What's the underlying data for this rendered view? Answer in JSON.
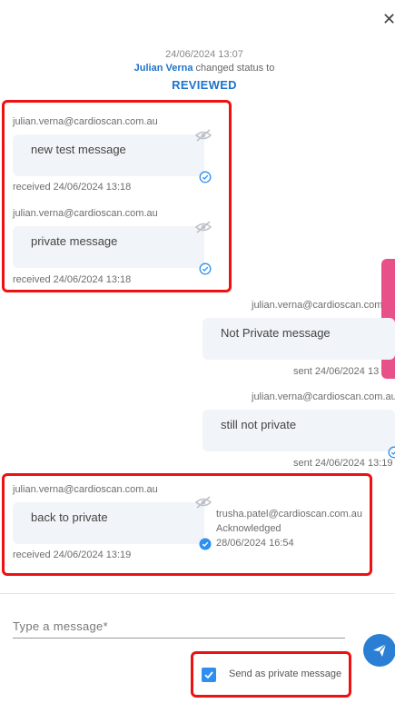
{
  "header": {
    "close_glyph": "✕"
  },
  "status_event": {
    "timestamp": "24/06/2024 13:07",
    "actor": "Julian Verna",
    "action_text": " changed status to",
    "new_status": "REVIEWED"
  },
  "messages": [
    {
      "sender": "julian.verna@cardioscan.com.au",
      "text": "new test message",
      "meta": "received 24/06/2024 13:18",
      "direction": "received",
      "private": true
    },
    {
      "sender": "julian.verna@cardioscan.com.au",
      "text": "private message",
      "meta": "received 24/06/2024 13:18",
      "direction": "received",
      "private": true
    },
    {
      "sender": "julian.verna@cardioscan.com",
      "text": "Not Private message",
      "meta": "sent 24/06/2024 13",
      "direction": "sent",
      "private": false
    },
    {
      "sender": "julian.verna@cardioscan.com.au",
      "text": "still not private",
      "meta": "sent 24/06/2024 13:19",
      "direction": "sent",
      "private": false
    },
    {
      "sender": "julian.verna@cardioscan.com.au",
      "text": "back to private",
      "meta": "received 24/06/2024 13:19",
      "direction": "received",
      "private": true,
      "ack": {
        "by": "trusha.patel@cardioscan.com.au",
        "label": "Acknowledged",
        "time": "28/06/2024 16:54"
      }
    }
  ],
  "composer": {
    "placeholder": "Type a message*",
    "private_label": "Send as private message",
    "private_checked": true
  },
  "colors": {
    "accent": "#2a7fd4",
    "highlight_box": "#ee1111",
    "side_tab": "#e8508a",
    "bubble_bg": "#f1f4f8"
  },
  "icons": [
    "close-icon",
    "eye-off-icon",
    "check-circle-icon",
    "send-icon",
    "checkbox-check-icon"
  ]
}
